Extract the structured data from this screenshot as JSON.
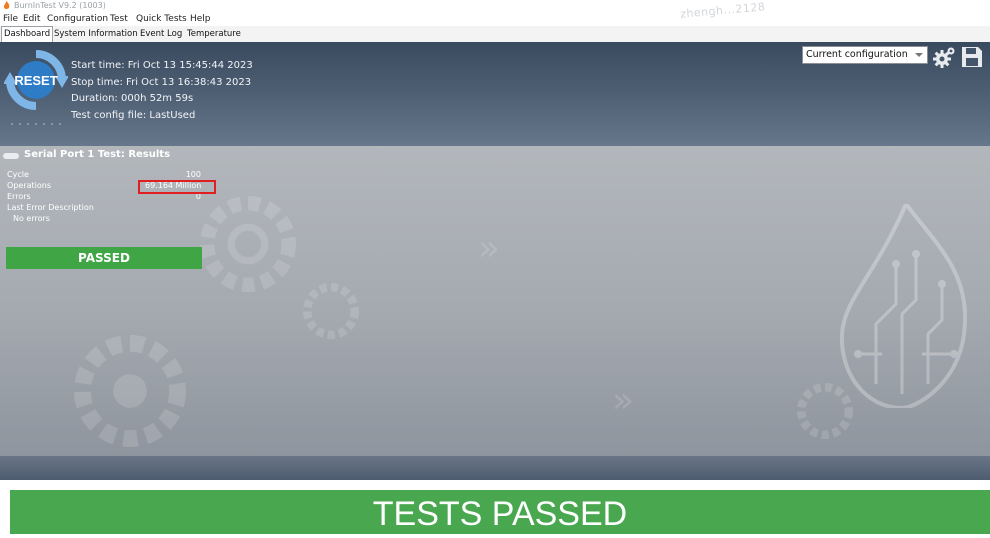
{
  "window": {
    "title": "BurnInTest V9.2 (1003)"
  },
  "watermark": "zhengh...2128",
  "menu": [
    "File",
    "Edit",
    "Configuration",
    "Test",
    "Quick Tests",
    "Help"
  ],
  "tabs": [
    "Dashboard",
    "System Information",
    "Event Log",
    "Temperature"
  ],
  "header": {
    "logo_text": "RESET",
    "start_time": "Start time: Fri Oct 13 15:45:44 2023",
    "stop_time": "Stop time: Fri Oct 13 16:38:43 2023",
    "duration": "Duration: 000h 52m 59s",
    "config_file": "Test config file: LastUsed",
    "config_select": "Current configuration"
  },
  "results": {
    "title": "Serial Port 1 Test: Results",
    "rows": [
      {
        "label": "Cycle",
        "value": "100"
      },
      {
        "label": "Operations",
        "value": "69.164 Million"
      },
      {
        "label": "Errors",
        "value": "0"
      },
      {
        "label": "Last Error Description",
        "value": ""
      }
    ],
    "error_desc": "No errors",
    "status": "PASSED"
  },
  "banner": "TESTS PASSED",
  "colors": {
    "header_bg": "#3a4a5e",
    "results_bg": "#a4a9b0",
    "passed_green": "#3fa545",
    "highlight_red": "#e02020",
    "reset_blue": "#2f7cc6"
  }
}
